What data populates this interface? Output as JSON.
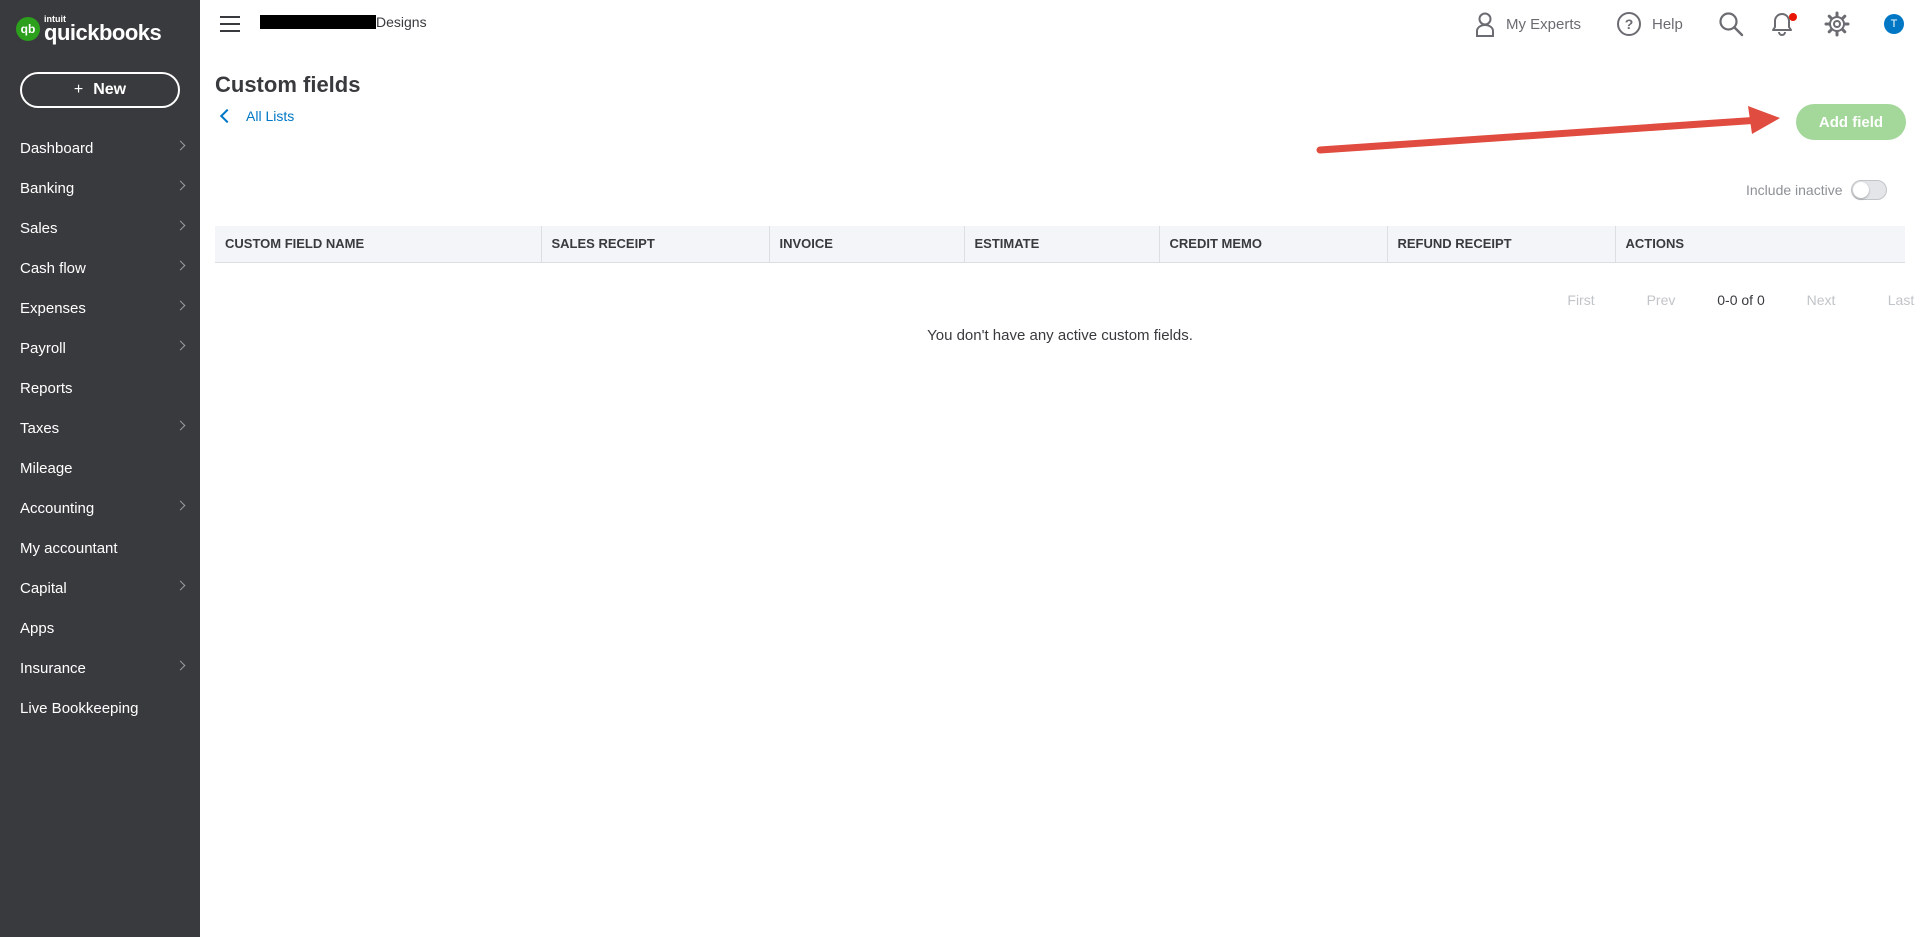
{
  "brand": {
    "intuit": "intuit",
    "name": "quickbooks",
    "badge": "qb",
    "accent": "#2ca01c"
  },
  "sidebar": {
    "new_label": "New",
    "items": [
      {
        "label": "Dashboard",
        "chevron": true
      },
      {
        "label": "Banking",
        "chevron": true
      },
      {
        "label": "Sales",
        "chevron": true
      },
      {
        "label": "Cash flow",
        "chevron": true
      },
      {
        "label": "Expenses",
        "chevron": true
      },
      {
        "label": "Payroll",
        "chevron": true
      },
      {
        "label": "Reports",
        "chevron": false
      },
      {
        "label": "Taxes",
        "chevron": true
      },
      {
        "label": "Mileage",
        "chevron": false
      },
      {
        "label": "Accounting",
        "chevron": true
      },
      {
        "label": "My accountant",
        "chevron": false
      },
      {
        "label": "Capital",
        "chevron": true
      },
      {
        "label": "Apps",
        "chevron": false
      },
      {
        "label": "Insurance",
        "chevron": true
      },
      {
        "label": "Live Bookkeeping",
        "chevron": false
      }
    ]
  },
  "header": {
    "company_suffix": "Designs",
    "my_experts": "My Experts",
    "help": "Help",
    "avatar_initial": "T",
    "notification_color": "#e81500"
  },
  "page": {
    "title": "Custom fields",
    "back_link": "All Lists",
    "add_button": "Add field",
    "include_inactive": "Include inactive",
    "include_inactive_on": false,
    "columns": [
      "CUSTOM FIELD NAME",
      "SALES RECEIPT",
      "INVOICE",
      "ESTIMATE",
      "CREDIT MEMO",
      "REFUND RECEIPT",
      "ACTIONS"
    ],
    "pager": {
      "first": "First",
      "prev": "Prev",
      "count": "0-0 of 0",
      "next": "Next",
      "last": "Last"
    },
    "empty_message": "You don't have any active custom fields."
  }
}
